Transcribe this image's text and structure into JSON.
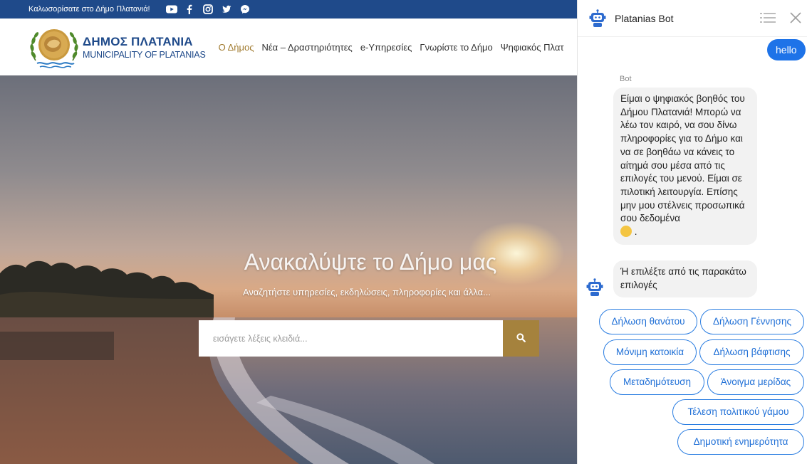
{
  "topbar": {
    "welcome": "Καλωσορίσατε στο Δήμο Πλατανιά!",
    "social_icons": [
      "youtube-icon",
      "facebook-icon",
      "instagram-icon",
      "twitter-icon",
      "messenger-icon"
    ]
  },
  "header": {
    "logo_title": "ΔΗΜΟΣ ΠΛΑΤΑΝΙΑ",
    "logo_subtitle": "MUNICIPALITY OF PLATANIAS",
    "nav": [
      {
        "label": "Ο Δήμος",
        "active": true
      },
      {
        "label": "Νέα – Δραστηριότητες",
        "active": false
      },
      {
        "label": "e-Υπηρεσίες",
        "active": false
      },
      {
        "label": "Γνωρίστε το Δήμο",
        "active": false
      },
      {
        "label": "Ψηφιακός Πλατ",
        "active": false
      }
    ]
  },
  "hero": {
    "title": "Ανακαλύψτε το Δήμο μας",
    "subtitle": "Αναζητήστε υπηρεσίες, εκδηλώσεις, πληροφορίες και άλλα...",
    "search_placeholder": "εισάγετε λέξεις κλειδιά..."
  },
  "chat": {
    "title": "Platanias Bot",
    "user_message": "hello",
    "bot_label": "Bot",
    "bot_message": "Είμαι ο ψηφιακός βοηθός του Δήμου Πλατανιά! Μπορώ να λέω τον καιρό, να σου δίνω πληροφορίες για το Δήμο και να σε βοηθάω να κάνεις το αίτημά σου μέσα από τις επιλογές του μενού. Είμαι σε πιλοτική λειτουργία. Επίσης μην μου στέλνεις προσωπικά σου δεδομένα",
    "bot_message_emoji": "😊",
    "bot_message_end": " .",
    "bot_message2": "Ή επιλέξτε από τις παρακάτω επιλογές",
    "options": [
      "Δήλωση θανάτου",
      "Δήλωση Γέννησης",
      "Μόνιμη κατοικία",
      "Δήλωση βάφτισης",
      "Μεταδημότευση",
      "Άνοιγμα μερίδας",
      "Τέλεση πολιτικού γάμου",
      "Δημοτική ενημερότητα"
    ]
  },
  "colors": {
    "topbar": "#1f4a8a",
    "brand_blue": "#1f4a8a",
    "accent_gold": "#a5823d",
    "chat_blue": "#1e73e8"
  }
}
